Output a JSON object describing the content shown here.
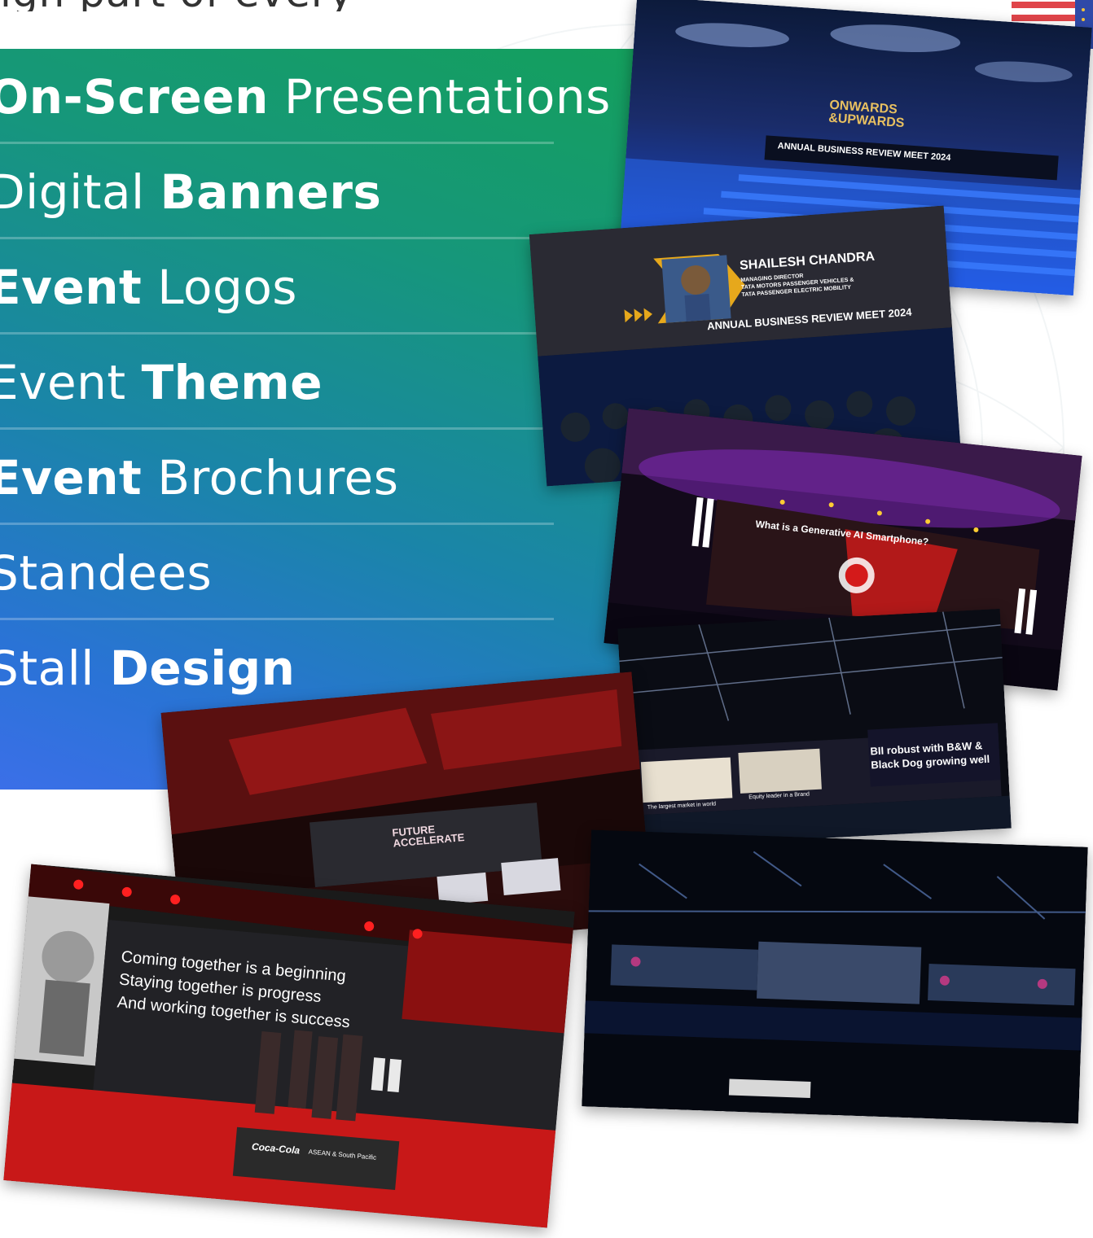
{
  "header": {
    "intro_fragment": "ign part of every"
  },
  "services": [
    {
      "bold_first": true,
      "bold": "On-Screen",
      "light": "Presentations"
    },
    {
      "bold_first": false,
      "light": "Digital",
      "bold": "Banners"
    },
    {
      "bold_first": true,
      "bold": "Event",
      "light": "Logos"
    },
    {
      "bold_first": false,
      "light": "Event",
      "bold": "Theme"
    },
    {
      "bold_first": true,
      "bold": "Event",
      "light": "Brochures"
    },
    {
      "bold_first": false,
      "light": "Standees",
      "bold": ""
    },
    {
      "bold_first": false,
      "light": "Stall",
      "bold": "Design"
    }
  ],
  "photos": {
    "onwards": {
      "logo_line1": "ONWARDS",
      "logo_line2": "&UPWARDS",
      "banner": "ANNUAL BUSINESS REVIEW MEET 2024"
    },
    "speaker": {
      "name": "SHAILESH CHANDRA",
      "role1": "MANAGING DIRECTOR",
      "role2": "TATA MOTORS PASSENGER VEHICLES &",
      "role3": "TATA PASSENGER ELECTRIC MOBILITY",
      "banner": "ANNUAL BUSINESS REVIEW MEET 2024"
    },
    "genai": {
      "title": "What is a Generative AI Smartphone?"
    },
    "bii": {
      "line1": "BII robust with B&W &",
      "line2": "Black Dog growing well",
      "caption1": "The largest market in world",
      "caption2": "Equity leader in a Brand"
    },
    "future": {
      "logo1": "FUTURE",
      "logo2": "ACCELERATE"
    },
    "quote": {
      "line1": "Coming together is a beginning",
      "line2": "Staying together is progress",
      "line3": "And working together is success",
      "brand": "Coca-Cola",
      "region": "ASEAN & South Pacific"
    }
  },
  "colors": {
    "panel_top": "#14a05a",
    "panel_bottom": "#3b6fe8"
  }
}
